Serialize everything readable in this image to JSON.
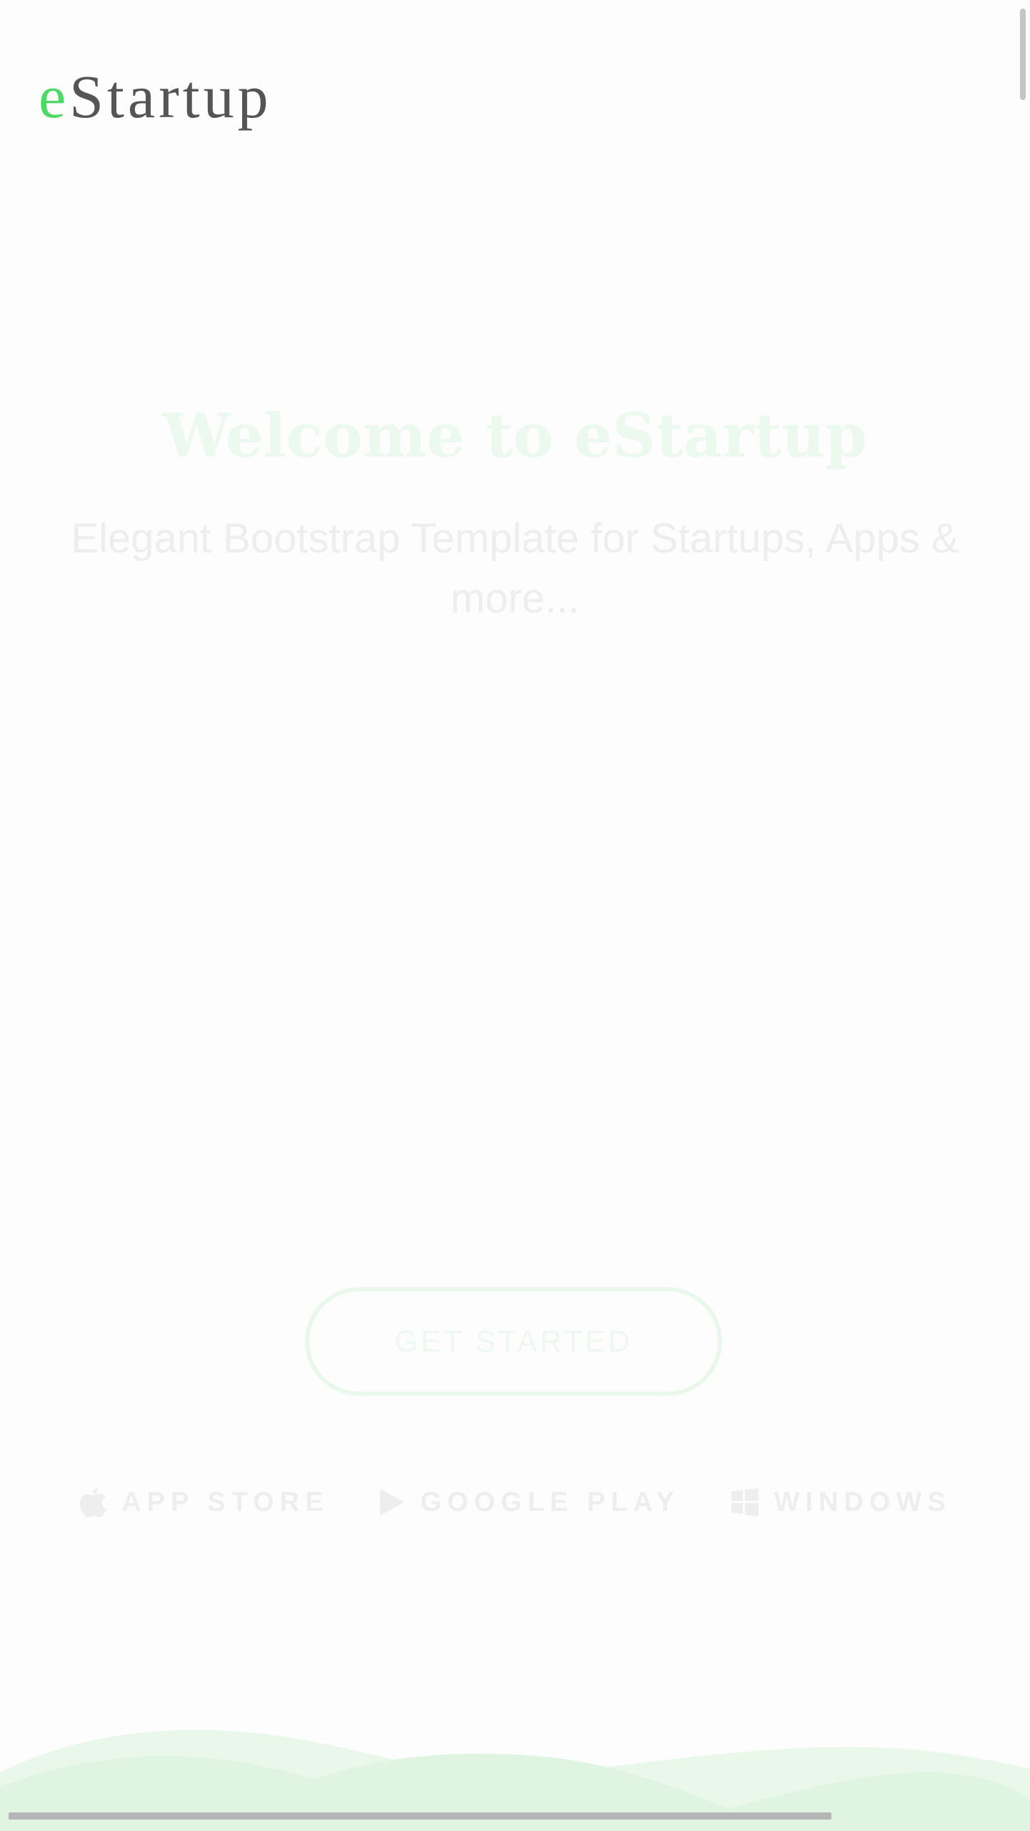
{
  "brand": {
    "logo_accent": "e",
    "logo_rest": "Startup",
    "accent_color": "#4cd964"
  },
  "hero": {
    "title": "Welcome to eStartup",
    "subtitle": "Elegant Bootstrap Template for Startups, Apps & more..."
  },
  "cta": {
    "label": "GET STARTED"
  },
  "stores": [
    {
      "label": "APP STORE",
      "icon": "apple-icon"
    },
    {
      "label": "GOOGLE PLAY",
      "icon": "play-icon"
    },
    {
      "label": "WINDOWS",
      "icon": "windows-icon"
    }
  ]
}
